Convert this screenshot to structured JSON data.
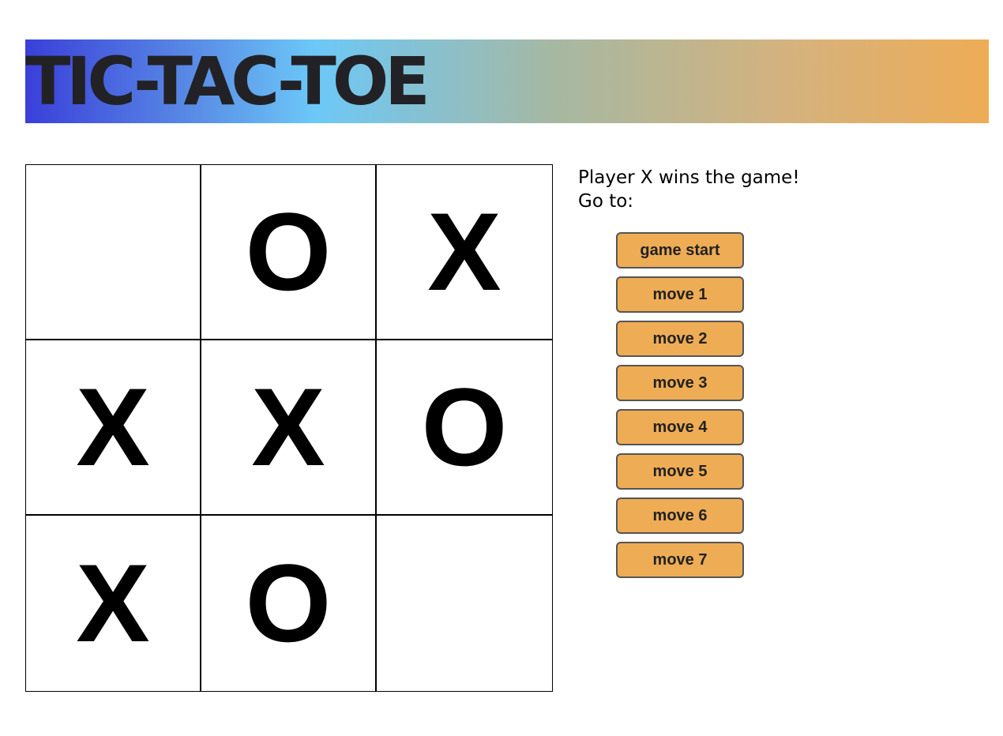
{
  "header": {
    "title": "TIC-TAC-TOE"
  },
  "board": {
    "squares": [
      "",
      "O",
      "X",
      "X",
      "X",
      "O",
      "X",
      "O",
      ""
    ]
  },
  "status": {
    "message": "Player X wins the game!",
    "goto_label": "Go to:"
  },
  "history": {
    "buttons": [
      "game start",
      "move 1",
      "move 2",
      "move 3",
      "move 4",
      "move 5",
      "move 6",
      "move 7"
    ]
  },
  "colors": {
    "button_bg": "#eeac55",
    "header_gradient_start": "#3a3fd9",
    "header_gradient_mid": "#6cc8f8",
    "header_gradient_end": "#eeac55"
  }
}
